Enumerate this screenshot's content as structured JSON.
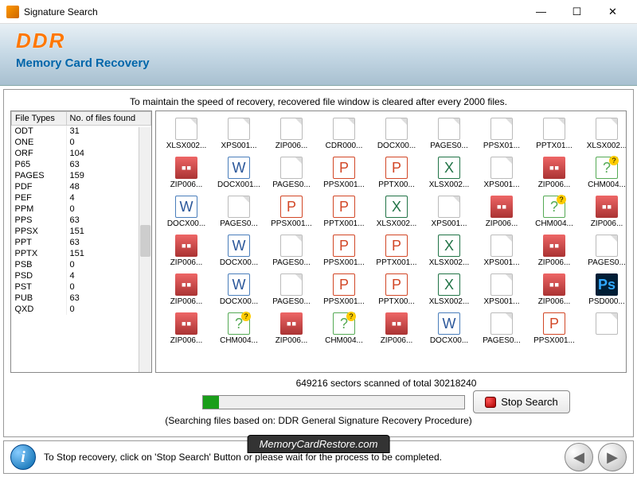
{
  "window": {
    "title": "Signature Search"
  },
  "header": {
    "logo": "DDR",
    "subtitle": "Memory Card Recovery"
  },
  "note": "To maintain the speed of recovery, recovered file window is cleared after every 2000 files.",
  "table": {
    "col1": "File Types",
    "col2": "No. of files found",
    "rows": [
      {
        "t": "ODT",
        "n": "31"
      },
      {
        "t": "ONE",
        "n": "0"
      },
      {
        "t": "ORF",
        "n": "104"
      },
      {
        "t": "P65",
        "n": "63"
      },
      {
        "t": "PAGES",
        "n": "159"
      },
      {
        "t": "PDF",
        "n": "48"
      },
      {
        "t": "PEF",
        "n": "4"
      },
      {
        "t": "PPM",
        "n": "0"
      },
      {
        "t": "PPS",
        "n": "63"
      },
      {
        "t": "PPSX",
        "n": "151"
      },
      {
        "t": "PPT",
        "n": "63"
      },
      {
        "t": "PPTX",
        "n": "151"
      },
      {
        "t": "PSB",
        "n": "0"
      },
      {
        "t": "PSD",
        "n": "4"
      },
      {
        "t": "PST",
        "n": "0"
      },
      {
        "t": "PUB",
        "n": "63"
      },
      {
        "t": "QXD",
        "n": "0"
      }
    ]
  },
  "files": [
    {
      "n": "XLSX002...",
      "k": "blank"
    },
    {
      "n": "XPS001...",
      "k": "blank"
    },
    {
      "n": "ZIP006...",
      "k": "blank"
    },
    {
      "n": "CDR000...",
      "k": "blank"
    },
    {
      "n": "DOCX00...",
      "k": "blank"
    },
    {
      "n": "PAGES0...",
      "k": "blank"
    },
    {
      "n": "PPSX01...",
      "k": "blank"
    },
    {
      "n": "PPTX01...",
      "k": "blank"
    },
    {
      "n": "XLSX002...",
      "k": "blank"
    },
    {
      "n": "ZIP006...",
      "k": "zip"
    },
    {
      "n": "DOCX001...",
      "k": "doc"
    },
    {
      "n": "PAGES0...",
      "k": "blank"
    },
    {
      "n": "PPSX001...",
      "k": "ppt"
    },
    {
      "n": "PPTX00...",
      "k": "ppt"
    },
    {
      "n": "XLSX002...",
      "k": "xls"
    },
    {
      "n": "XPS001...",
      "k": "blank"
    },
    {
      "n": "ZIP006...",
      "k": "zip"
    },
    {
      "n": "CHM004...",
      "k": "chm"
    },
    {
      "n": "DOCX00...",
      "k": "doc"
    },
    {
      "n": "PAGES0...",
      "k": "blank"
    },
    {
      "n": "PPSX001...",
      "k": "ppt"
    },
    {
      "n": "PPTX001...",
      "k": "ppt"
    },
    {
      "n": "XLSX002...",
      "k": "xls"
    },
    {
      "n": "XPS001...",
      "k": "blank"
    },
    {
      "n": "ZIP006...",
      "k": "zip"
    },
    {
      "n": "CHM004...",
      "k": "chm"
    },
    {
      "n": "ZIP006...",
      "k": "zip"
    },
    {
      "n": "ZIP006...",
      "k": "zip"
    },
    {
      "n": "DOCX00...",
      "k": "doc"
    },
    {
      "n": "PAGES0...",
      "k": "blank"
    },
    {
      "n": "PPSX001...",
      "k": "ppt"
    },
    {
      "n": "PPTX001...",
      "k": "ppt"
    },
    {
      "n": "XLSX002...",
      "k": "xls"
    },
    {
      "n": "XPS001...",
      "k": "blank"
    },
    {
      "n": "ZIP006...",
      "k": "zip"
    },
    {
      "n": "PAGES0...",
      "k": "blank"
    },
    {
      "n": "ZIP006...",
      "k": "zip"
    },
    {
      "n": "DOCX00...",
      "k": "doc"
    },
    {
      "n": "PAGES0...",
      "k": "blank"
    },
    {
      "n": "PPSX001...",
      "k": "ppt"
    },
    {
      "n": "PPTX00...",
      "k": "ppt"
    },
    {
      "n": "XLSX002...",
      "k": "xls"
    },
    {
      "n": "XPS001...",
      "k": "blank"
    },
    {
      "n": "ZIP006...",
      "k": "zip"
    },
    {
      "n": "PSD000...",
      "k": "psd"
    },
    {
      "n": "ZIP006...",
      "k": "zip"
    },
    {
      "n": "CHM004...",
      "k": "chm"
    },
    {
      "n": "ZIP006...",
      "k": "zip"
    },
    {
      "n": "CHM004...",
      "k": "chm"
    },
    {
      "n": "ZIP006...",
      "k": "zip"
    },
    {
      "n": "DOCX00...",
      "k": "doc"
    },
    {
      "n": "PAGES0...",
      "k": "blank"
    },
    {
      "n": "PPSX001...",
      "k": "ppt"
    },
    {
      "n": "",
      "k": "blank"
    }
  ],
  "progress": {
    "label": "649216 sectors scanned of total 30218240",
    "procedure": "(Searching files based on:  DDR General Signature Recovery Procedure)",
    "stop": "Stop Search"
  },
  "footer": {
    "msg": "To Stop recovery, click on 'Stop Search' Button or please wait for the process to be completed."
  },
  "watermark": "MemoryCardRestore.com"
}
